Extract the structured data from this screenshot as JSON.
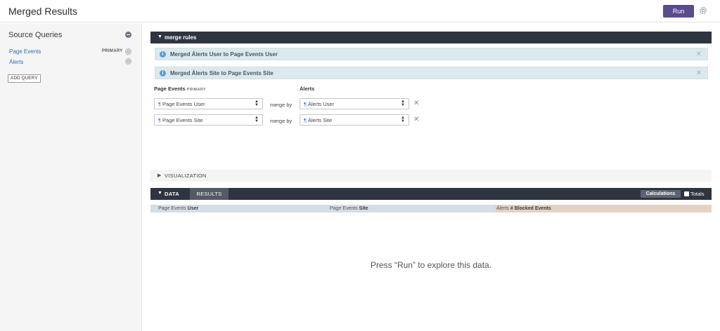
{
  "header": {
    "title": "Merged Results",
    "run_label": "Run"
  },
  "sidebar": {
    "title": "Source Queries",
    "queries": [
      {
        "label": "Page Events",
        "badge": "PRIMARY"
      },
      {
        "label": "Álerts",
        "badge": ""
      }
    ],
    "add_query_label": "ADD QUERY"
  },
  "merge_rules": {
    "bar_label": "merge rules",
    "alerts": [
      "Merged Álerts User to Page Events User",
      "Merged Álerts Site to Page Events Site"
    ],
    "left_heading": "Page Events",
    "left_heading_badge": "PRIMARY",
    "right_heading": "Álerts",
    "merge_by_label": "merge by",
    "rows": [
      {
        "left": "Page Events User",
        "right": "Álerts User"
      },
      {
        "left": "Page Events Site",
        "right": "Álerts Site"
      }
    ]
  },
  "visualization": {
    "label": "VISUALIZATION"
  },
  "data_panel": {
    "data_tab": "DATA",
    "results_tab": "RESULTS",
    "calculations_label": "Calculations",
    "totals_label": "Totals",
    "columns": [
      {
        "view": "Page Events",
        "field": "User"
      },
      {
        "view": "Page Events",
        "field": "Site"
      },
      {
        "view": "Álerts",
        "field": "# Blocked Events"
      }
    ],
    "empty_message": "Press “Run” to explore this data."
  },
  "icons": {
    "gear": "gear-icon",
    "collapse": "minus-circle-icon",
    "info": "info-icon",
    "close": "close-icon",
    "caret": "caret-icon"
  },
  "colors": {
    "run_button": "#5a4a8e",
    "dark_bar": "#2f3540",
    "alert_bg": "#dce9ec",
    "dimension_header": "#d5dde5",
    "measure_header": "#e4d2c5",
    "link": "#2a6eb5"
  }
}
